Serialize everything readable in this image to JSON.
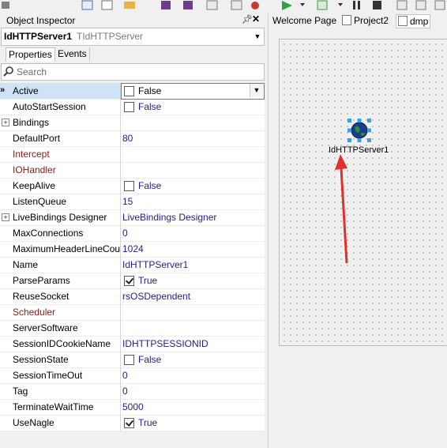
{
  "inspector": {
    "title": "Object Inspector",
    "component_name": "IdHTTPServer1",
    "component_class": "TIdHTTPServer",
    "tabs": [
      "Properties",
      "Events"
    ],
    "search_placeholder": "Search"
  },
  "properties": [
    {
      "name": "Active",
      "value": "False",
      "checkbox": true,
      "checked": false,
      "selected": true
    },
    {
      "name": "AutoStartSession",
      "value": "False",
      "checkbox": true,
      "checked": false
    },
    {
      "name": "Bindings",
      "value": "",
      "expandable": true
    },
    {
      "name": "DefaultPort",
      "value": "80"
    },
    {
      "name": "Intercept",
      "value": "",
      "event": true
    },
    {
      "name": "IOHandler",
      "value": "",
      "event": true
    },
    {
      "name": "KeepAlive",
      "value": "False",
      "checkbox": true,
      "checked": false
    },
    {
      "name": "ListenQueue",
      "value": "15"
    },
    {
      "name": "LiveBindings Designer",
      "value": "LiveBindings Designer",
      "expandable": true
    },
    {
      "name": "MaxConnections",
      "value": "0"
    },
    {
      "name": "MaximumHeaderLineCount",
      "value": "1024"
    },
    {
      "name": "Name",
      "value": "IdHTTPServer1"
    },
    {
      "name": "ParseParams",
      "value": "True",
      "checkbox": true,
      "checked": true
    },
    {
      "name": "ReuseSocket",
      "value": "rsOSDependent"
    },
    {
      "name": "Scheduler",
      "value": "",
      "event": true
    },
    {
      "name": "ServerSoftware",
      "value": ""
    },
    {
      "name": "SessionIDCookieName",
      "value": "IDHTTPSESSIONID"
    },
    {
      "name": "SessionState",
      "value": "False",
      "checkbox": true,
      "checked": false
    },
    {
      "name": "SessionTimeOut",
      "value": "0"
    },
    {
      "name": "Tag",
      "value": "0"
    },
    {
      "name": "TerminateWaitTime",
      "value": "5000"
    },
    {
      "name": "UseNagle",
      "value": "True",
      "checkbox": true,
      "checked": true
    }
  ],
  "editor_tabs": [
    "Welcome Page",
    "Project2",
    "dmp"
  ],
  "designer": {
    "component_label": "IdHTTPServer1",
    "icon": "globe-icon",
    "annotation": "red-arrow"
  },
  "colors": {
    "event_property": "#8b1a1a",
    "value_text": "#1f1f8f",
    "selected_row": "#cfe3f7",
    "arrow": "#e03030"
  }
}
